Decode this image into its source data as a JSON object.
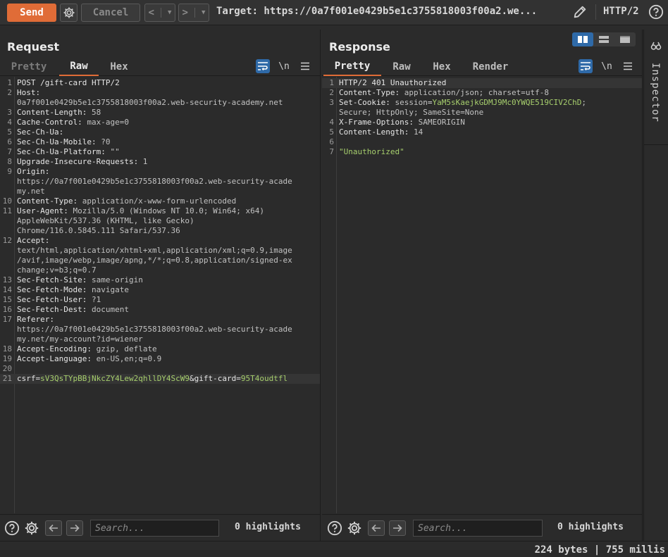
{
  "toolbar": {
    "send_label": "Send",
    "cancel_label": "Cancel",
    "back_label": "<",
    "fwd_label": ">",
    "target": "Target: https://0a7f001e0429b5e1c3755818003f00a2.we...",
    "protocol": "HTTP/2"
  },
  "request": {
    "title": "Request",
    "tabs": [
      "Pretty",
      "Raw",
      "Hex"
    ],
    "active_tab": "Raw",
    "newline_label": "\\n",
    "lines": [
      {
        "n": "1",
        "parts": [
          {
            "t": "POST /gift-card HTTP/2",
            "c": "k"
          }
        ]
      },
      {
        "n": "2",
        "parts": [
          {
            "t": "Host:",
            "c": "k"
          }
        ]
      },
      {
        "n": "",
        "parts": [
          {
            "t": "0a7f001e0429b5e1c3755818003f00a2.web-security-academy.net",
            "c": "v"
          }
        ]
      },
      {
        "n": "3",
        "parts": [
          {
            "t": "Content-Length:",
            "c": "k"
          },
          {
            "t": " 58",
            "c": "v"
          }
        ]
      },
      {
        "n": "4",
        "parts": [
          {
            "t": "Cache-Control:",
            "c": "k"
          },
          {
            "t": " max-age=0",
            "c": "v"
          }
        ]
      },
      {
        "n": "5",
        "parts": [
          {
            "t": "Sec-Ch-Ua:",
            "c": "k"
          }
        ]
      },
      {
        "n": "6",
        "parts": [
          {
            "t": "Sec-Ch-Ua-Mobile:",
            "c": "k"
          },
          {
            "t": " ?0",
            "c": "v"
          }
        ]
      },
      {
        "n": "7",
        "parts": [
          {
            "t": "Sec-Ch-Ua-Platform:",
            "c": "k"
          },
          {
            "t": " \"\"",
            "c": "v"
          }
        ]
      },
      {
        "n": "8",
        "parts": [
          {
            "t": "Upgrade-Insecure-Requests:",
            "c": "k"
          },
          {
            "t": " 1",
            "c": "v"
          }
        ]
      },
      {
        "n": "9",
        "parts": [
          {
            "t": "Origin:",
            "c": "k"
          }
        ]
      },
      {
        "n": "",
        "parts": [
          {
            "t": "https://0a7f001e0429b5e1c3755818003f00a2.web-security-acade",
            "c": "v"
          }
        ]
      },
      {
        "n": "",
        "parts": [
          {
            "t": "my.net",
            "c": "v"
          }
        ]
      },
      {
        "n": "10",
        "parts": [
          {
            "t": "Content-Type:",
            "c": "k"
          },
          {
            "t": " application/x-www-form-urlencoded",
            "c": "v"
          }
        ]
      },
      {
        "n": "11",
        "parts": [
          {
            "t": "User-Agent:",
            "c": "k"
          },
          {
            "t": " Mozilla/5.0 (Windows NT 10.0; Win64; x64)",
            "c": "v"
          }
        ]
      },
      {
        "n": "",
        "parts": [
          {
            "t": "AppleWebKit/537.36 (KHTML, like Gecko)",
            "c": "v"
          }
        ]
      },
      {
        "n": "",
        "parts": [
          {
            "t": "Chrome/116.0.5845.111 Safari/537.36",
            "c": "v"
          }
        ]
      },
      {
        "n": "12",
        "parts": [
          {
            "t": "Accept:",
            "c": "k"
          }
        ]
      },
      {
        "n": "",
        "parts": [
          {
            "t": "text/html,application/xhtml+xml,application/xml;q=0.9,image",
            "c": "v"
          }
        ]
      },
      {
        "n": "",
        "parts": [
          {
            "t": "/avif,image/webp,image/apng,*/*;q=0.8,application/signed-ex",
            "c": "v"
          }
        ]
      },
      {
        "n": "",
        "parts": [
          {
            "t": "change;v=b3;q=0.7",
            "c": "v"
          }
        ]
      },
      {
        "n": "13",
        "parts": [
          {
            "t": "Sec-Fetch-Site:",
            "c": "k"
          },
          {
            "t": " same-origin",
            "c": "v"
          }
        ]
      },
      {
        "n": "14",
        "parts": [
          {
            "t": "Sec-Fetch-Mode:",
            "c": "k"
          },
          {
            "t": " navigate",
            "c": "v"
          }
        ]
      },
      {
        "n": "15",
        "parts": [
          {
            "t": "Sec-Fetch-User:",
            "c": "k"
          },
          {
            "t": " ?1",
            "c": "v"
          }
        ]
      },
      {
        "n": "16",
        "parts": [
          {
            "t": "Sec-Fetch-Dest:",
            "c": "k"
          },
          {
            "t": " document",
            "c": "v"
          }
        ]
      },
      {
        "n": "17",
        "parts": [
          {
            "t": "Referer:",
            "c": "k"
          }
        ]
      },
      {
        "n": "",
        "parts": [
          {
            "t": "https://0a7f001e0429b5e1c3755818003f00a2.web-security-acade",
            "c": "v"
          }
        ]
      },
      {
        "n": "",
        "parts": [
          {
            "t": "my.net/my-account?id=wiener",
            "c": "v"
          }
        ]
      },
      {
        "n": "18",
        "parts": [
          {
            "t": "Accept-Encoding:",
            "c": "k"
          },
          {
            "t": " gzip, deflate",
            "c": "v"
          }
        ]
      },
      {
        "n": "19",
        "parts": [
          {
            "t": "Accept-Language:",
            "c": "k"
          },
          {
            "t": " en-US,en;q=0.9",
            "c": "v"
          }
        ]
      },
      {
        "n": "20",
        "parts": []
      },
      {
        "n": "21",
        "hl": true,
        "parts": [
          {
            "t": "csrf",
            "c": "k"
          },
          {
            "t": "=",
            "c": "eq"
          },
          {
            "t": "sV3QsTYpBBjNkcZY4Lew2qhllDY4ScW9",
            "c": "p"
          },
          {
            "t": "&gift-card",
            "c": "k"
          },
          {
            "t": "=",
            "c": "eq"
          },
          {
            "t": "95T4oudtfl",
            "c": "p"
          }
        ]
      }
    ],
    "search_placeholder": "Search...",
    "highlights": "0 highlights"
  },
  "response": {
    "title": "Response",
    "tabs": [
      "Pretty",
      "Raw",
      "Hex",
      "Render"
    ],
    "active_tab": "Pretty",
    "newline_label": "\\n",
    "lines": [
      {
        "n": "1",
        "hl": true,
        "parts": [
          {
            "t": "HTTP/2 401 Unauthorized",
            "c": "k"
          }
        ]
      },
      {
        "n": "2",
        "parts": [
          {
            "t": "Content-Type:",
            "c": "k"
          },
          {
            "t": " application/json; charset=utf-8",
            "c": "v"
          }
        ]
      },
      {
        "n": "3",
        "parts": [
          {
            "t": "Set-Cookie:",
            "c": "k"
          },
          {
            "t": " session",
            "c": "v"
          },
          {
            "t": "=",
            "c": "eq"
          },
          {
            "t": "YaM5sKaejkGDMJ9Mc0YWQE519CIV2ChD",
            "c": "p"
          },
          {
            "t": ";",
            "c": "v"
          }
        ]
      },
      {
        "n": "",
        "parts": [
          {
            "t": "Secure; HttpOnly; SameSite=None",
            "c": "v"
          }
        ]
      },
      {
        "n": "4",
        "parts": [
          {
            "t": "X-Frame-Options:",
            "c": "k"
          },
          {
            "t": " SAMEORIGIN",
            "c": "v"
          }
        ]
      },
      {
        "n": "5",
        "parts": [
          {
            "t": "Content-Length:",
            "c": "k"
          },
          {
            "t": " 14",
            "c": "v"
          }
        ]
      },
      {
        "n": "6",
        "parts": []
      },
      {
        "n": "7",
        "parts": [
          {
            "t": "\"Unauthorized\"",
            "c": "str"
          }
        ]
      }
    ],
    "search_placeholder": "Search...",
    "highlights": "0 highlights"
  },
  "inspector": {
    "label": "Inspector"
  },
  "status": {
    "text": "224 bytes | 755 millis"
  },
  "colors": {
    "accent": "#e06c37",
    "active_blue": "#2f6aa8",
    "param_green": "#a7cf6d"
  }
}
